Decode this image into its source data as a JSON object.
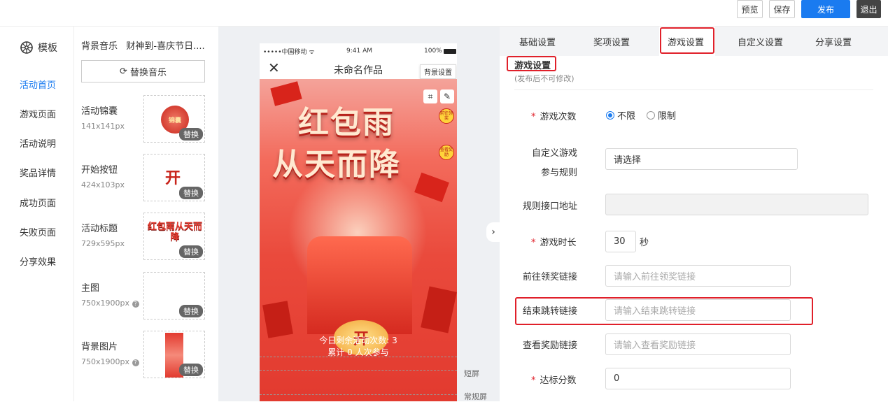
{
  "toolbar": {
    "preview": "预览",
    "save": "保存",
    "publish": "发布",
    "exit": "退出"
  },
  "nav": {
    "logo": "模板",
    "items": [
      "活动首页",
      "游戏页面",
      "活动说明",
      "奖品详情",
      "成功页面",
      "失败页面",
      "分享效果"
    ],
    "active_index": 0
  },
  "assets": {
    "music_label": "背景音乐",
    "music_name": "财神到-喜庆节日....",
    "replace_music": "替换音乐",
    "replace": "替换",
    "items": [
      {
        "name": "活动锦囊",
        "size": "141x141px"
      },
      {
        "name": "开始按钮",
        "size": "424x103px"
      },
      {
        "name": "活动标题",
        "size": "729x595px"
      },
      {
        "name": "主图",
        "size": "750x1900px"
      },
      {
        "name": "背景图片",
        "size": "750x1900px"
      }
    ]
  },
  "phone": {
    "carrier": "•••••中国移动",
    "time": "9:41 AM",
    "battery": "100%",
    "title": "未命名作品",
    "bg_settings": "背景设置",
    "title_line1": "红包雨",
    "title_line2": "从天而降",
    "badge1": "前往领奖",
    "badge2": "查看奖励",
    "coin": "开",
    "remaining": "今日剩余活动次数: 3",
    "participants": "累计 0 人次参与",
    "short_screen": "短屏",
    "normal_screen": "常规屏",
    "thumb_badge": "锦囊",
    "thumb_title": "红包雨从天而降"
  },
  "panel": {
    "tabs": [
      "基础设置",
      "奖项设置",
      "游戏设置",
      "自定义设置",
      "分享设置"
    ],
    "active_tab": 2,
    "section_title": "游戏设置",
    "section_sub": "(发布后不可修改)",
    "fields": {
      "play_count": {
        "label": "游戏次数",
        "opt_unlimited": "不限",
        "opt_limited": "限制",
        "selected": "不限"
      },
      "custom_rule": {
        "label1": "自定义游戏",
        "label2": "参与规则",
        "value": "请选择"
      },
      "rule_api": {
        "label": "规则接口地址",
        "value": ""
      },
      "duration": {
        "label": "游戏时长",
        "value": "30",
        "unit": "秒"
      },
      "claim_link": {
        "label": "前往领奖链接",
        "placeholder": "请输入前往领奖链接"
      },
      "end_link": {
        "label": "结束跳转链接",
        "placeholder": "请输入结束跳转链接"
      },
      "reward_link": {
        "label": "查看奖励链接",
        "placeholder": "请输入查看奖励链接"
      },
      "score": {
        "label": "达标分数",
        "value": "0"
      }
    }
  },
  "colors": {
    "accent": "#1a7bf0",
    "highlight": "#e0202a",
    "poster_red": "#e23a2f"
  }
}
